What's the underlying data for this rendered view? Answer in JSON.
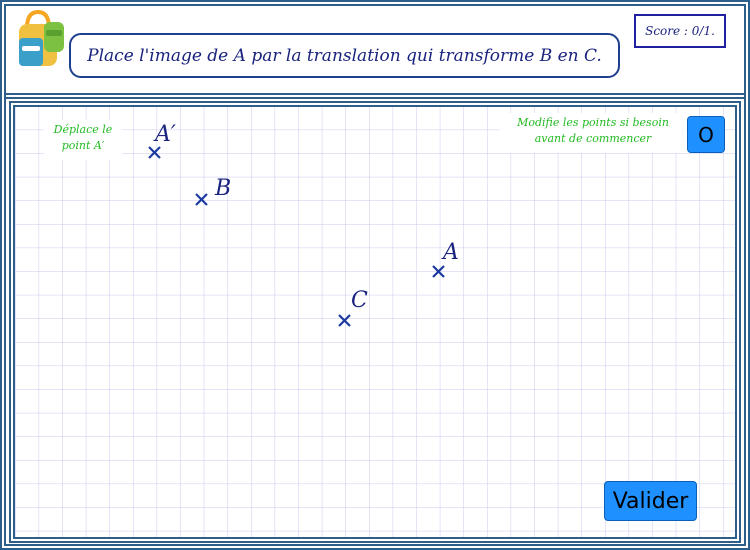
{
  "instruction": "Place l'image de A par la translation qui transforme B en C.",
  "score": "Score : 0/1.",
  "hint_left": [
    "Déplace le",
    "point A′"
  ],
  "hint_right": [
    "Modifie les points si besoin",
    "avant de commencer"
  ],
  "reset_label": "O",
  "validate_label": "Valider",
  "points": [
    {
      "id": "A-prime",
      "label": "A′"
    },
    {
      "id": "B",
      "label": "B"
    },
    {
      "id": "C",
      "label": "C"
    },
    {
      "id": "A",
      "label": "A"
    }
  ],
  "colors": {
    "border": "#2e5e8a",
    "grid": "#c9c9f0",
    "point": "#1a237e",
    "hint": "#22bb22",
    "button": "#1e90ff"
  },
  "icons": [
    "backpack-icon"
  ]
}
